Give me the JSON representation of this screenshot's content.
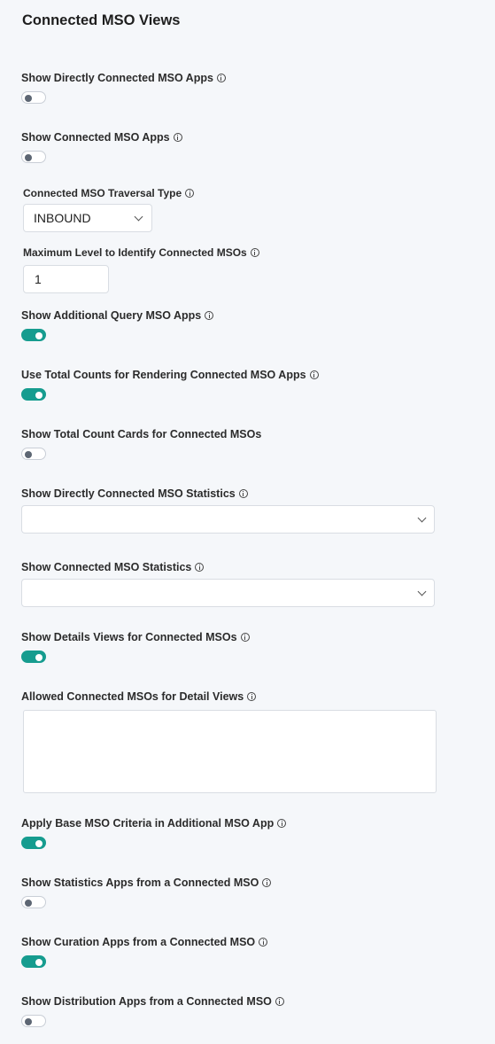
{
  "section_title": "Connected MSO Views",
  "colors": {
    "toggle_on": "#169c8f",
    "toggle_off_knob": "#5d6673"
  },
  "fields": {
    "directly_connected_apps": {
      "label": "Show Directly Connected MSO Apps",
      "enabled": false
    },
    "connected_apps": {
      "label": "Show Connected MSO Apps",
      "enabled": false
    },
    "traversal_type": {
      "label": "Connected MSO Traversal Type",
      "value": "INBOUND"
    },
    "max_level": {
      "label": "Maximum Level to Identify Connected MSOs",
      "value": "1"
    },
    "additional_query_apps": {
      "label": "Show Additional Query MSO Apps",
      "enabled": true
    },
    "use_total_counts": {
      "label": "Use Total Counts for Rendering Connected MSO Apps",
      "enabled": true
    },
    "total_count_cards": {
      "label": "Show Total Count Cards for Connected MSOs",
      "enabled": false
    },
    "directly_connected_stats": {
      "label": "Show Directly Connected MSO Statistics",
      "value": ""
    },
    "connected_stats": {
      "label": "Show Connected MSO Statistics",
      "value": ""
    },
    "details_views": {
      "label": "Show Details Views for Connected MSOs",
      "enabled": true
    },
    "allowed_detail_views": {
      "label": "Allowed Connected MSOs for Detail Views",
      "value": ""
    },
    "apply_base_criteria": {
      "label": "Apply Base MSO Criteria in Additional MSO App",
      "enabled": true
    },
    "statistics_apps": {
      "label": "Show Statistics Apps from a Connected MSO",
      "enabled": false
    },
    "curation_apps": {
      "label": "Show Curation Apps from a Connected MSO",
      "enabled": true
    },
    "distribution_apps": {
      "label": "Show Distribution Apps from a Connected MSO",
      "enabled": false
    }
  }
}
